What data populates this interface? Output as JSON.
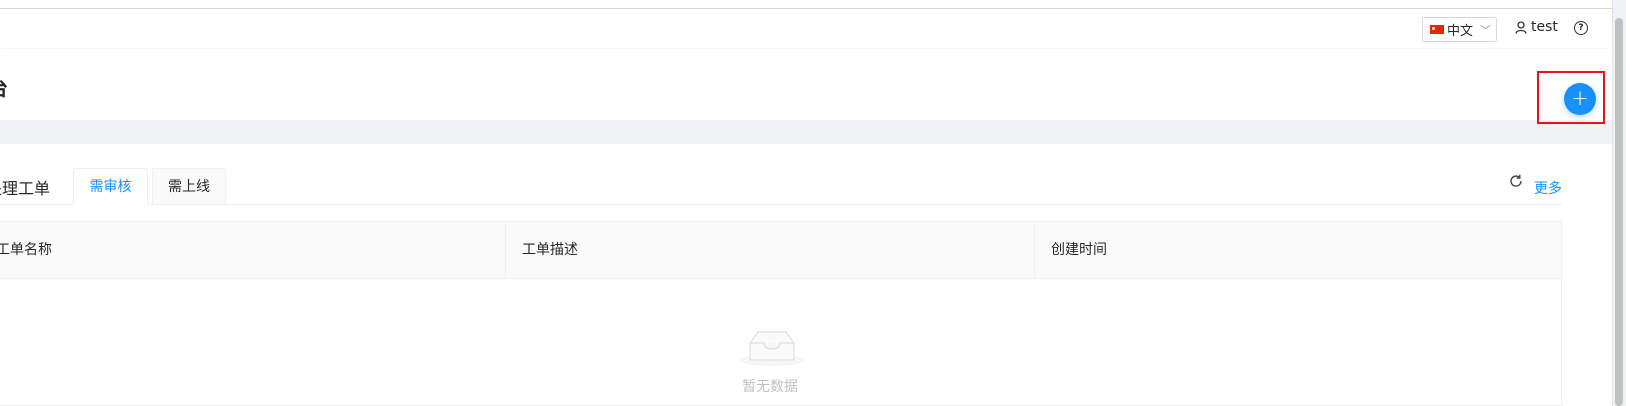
{
  "header": {
    "language": "中文",
    "username": "test",
    "help_symbol": "?"
  },
  "page": {
    "title": "台",
    "add_symbol": "+"
  },
  "section": {
    "title": "处理工单",
    "tabs": [
      {
        "label": "需审核",
        "active": true
      },
      {
        "label": "需上线",
        "active": false
      }
    ],
    "more_label": "更多"
  },
  "table": {
    "columns": [
      "工单名称",
      "工单描述",
      "创建时间"
    ],
    "rows": [],
    "empty_text": "暂无数据"
  },
  "icons": {
    "user": "user-icon",
    "help": "question-circle-icon",
    "refresh": "refresh-icon",
    "empty": "inbox-empty-icon",
    "flag": "china-flag-icon",
    "dropdown": "chevron-down-icon"
  },
  "colors": {
    "primary": "#1890ff",
    "highlight_box": "#e8131a",
    "page_background": "#f0f2f5"
  }
}
